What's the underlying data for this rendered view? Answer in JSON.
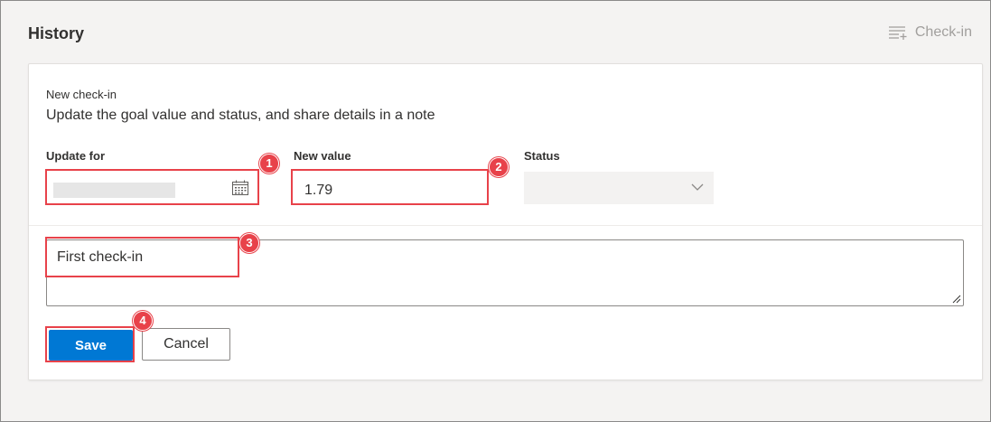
{
  "header": {
    "title": "History",
    "checkin_label": "Check-in"
  },
  "card": {
    "subtitle": "New check-in",
    "description": "Update the goal value and status, and share details in a note",
    "update_for_label": "Update for",
    "new_value_label": "New value",
    "new_value": "1.79",
    "status_label": "Status",
    "status_value": "",
    "note_text": "First check-in",
    "save_label": "Save",
    "cancel_label": "Cancel"
  },
  "callouts": [
    "1",
    "2",
    "3",
    "4"
  ],
  "colors": {
    "accent": "#0078d4",
    "highlight": "#e8424a"
  }
}
